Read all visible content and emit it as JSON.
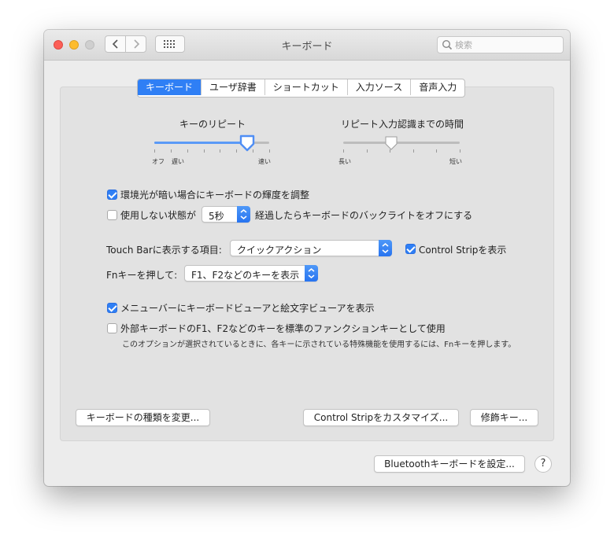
{
  "window": {
    "title": "キーボード"
  },
  "search": {
    "placeholder": "検索"
  },
  "tabs": [
    {
      "label": "キーボード",
      "active": true
    },
    {
      "label": "ユーザ辞書",
      "active": false
    },
    {
      "label": "ショートカット",
      "active": false
    },
    {
      "label": "入力ソース",
      "active": false
    },
    {
      "label": "音声入力",
      "active": false
    }
  ],
  "key_repeat": {
    "title": "キーのリピート",
    "min_label_1": "オフ",
    "min_label_2": "遅い",
    "max_label": "速い",
    "level": 0.81
  },
  "delay_until_repeat": {
    "title": "リピート入力認識までの時間",
    "min_label": "長い",
    "max_label": "短い",
    "level": 0.41
  },
  "options": {
    "ambient_light": {
      "label": "環境光が暗い場合にキーボードの輝度を調整",
      "checked": true
    },
    "backlight_off": {
      "label_before": "使用しない状態が",
      "duration": "5秒",
      "label_after": "経過したらキーボードのバックライトをオフにする",
      "checked": false
    },
    "touchbar_label": "Touch Barに表示する項目:",
    "touchbar_value": "クイックアクション",
    "control_strip": {
      "label": "Control Stripを表示",
      "checked": true
    },
    "fn_label": "Fnキーを押して:",
    "fn_value": "F1、F2などのキーを表示",
    "menubar_viewer": {
      "label": "メニューバーにキーボードビューアと絵文字ビューアを表示",
      "checked": true
    },
    "external_fn": {
      "label": "外部キーボードのF1、F2などのキーを標準のファンクションキーとして使用",
      "checked": false
    },
    "external_fn_note": "このオプションが選択されているときに、各キーに示されている特殊機能を使用するには、Fnキーを押します。"
  },
  "buttons": {
    "change_type": "キーボードの種類を変更...",
    "customize_strip": "Control Stripをカスタマイズ...",
    "modifier_keys": "修飾キー...",
    "bluetooth": "Bluetoothキーボードを設定...",
    "help": "?"
  },
  "colors": {
    "accent": "#2f7ff5"
  }
}
